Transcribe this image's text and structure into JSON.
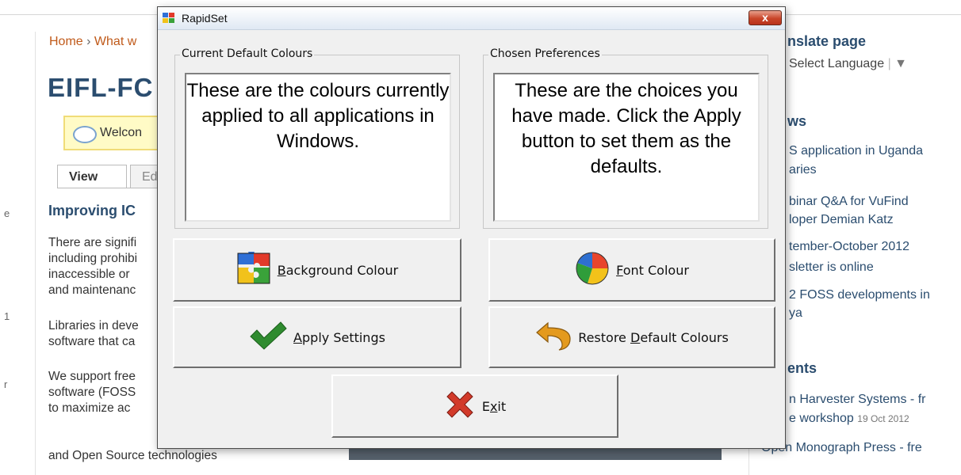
{
  "background_page": {
    "breadcrumb_home": "Home",
    "breadcrumb_sep": "›",
    "breadcrumb_next": "What w",
    "site_title": "EIFL-FC",
    "welcome_text": "Welcon",
    "tabs": [
      "View",
      "Ed"
    ],
    "section_heading": "Improving IC",
    "paragraph_lines": [
      "There are signifi",
      "including prohibi",
      "inaccessible or",
      "and maintenanc",
      "Libraries in deve",
      "software that ca",
      "We support free",
      "software (FOSS",
      "to maximize ac",
      "and Open Source technologies"
    ],
    "left_edge_glyphs": [
      "e",
      "1",
      "r"
    ],
    "right": {
      "translate_title": "nslate page",
      "language_select": "Select Language",
      "language_sep": "|",
      "language_arrow": "▼",
      "news_title": "ws",
      "news_items": [
        "S application in Uganda",
        "aries",
        "binar Q&A for VuFind",
        "loper Demian Katz",
        "tember-October 2012",
        "sletter is online",
        "2 FOSS developments in",
        "ya"
      ],
      "events_title": "ents",
      "event_items": [
        "n Harvester Systems - fr",
        "e workshop",
        "n Monograph Press - fre"
      ],
      "event_date": "19 Oct 2012",
      "event_prefix": "Ope"
    }
  },
  "dialog": {
    "title": "RapidSet",
    "close_glyph": "x",
    "current_group_label": "Current Default Colours",
    "current_text": "These are the colours currently applied to all applications in Windows.",
    "chosen_group_label": "Chosen Preferences",
    "chosen_text": "These are the choices you have made.  Click the Apply button to set them as the defaults.",
    "buttons": {
      "background": {
        "mnemonic": "B",
        "rest": "ackground Colour"
      },
      "font": {
        "mnemonic": "F",
        "rest": "ont Colour"
      },
      "apply": {
        "mnemonic": "A",
        "rest": "pply Settings"
      },
      "restore": {
        "pre": "Restore ",
        "mnemonic": "D",
        "rest": "efault Colours"
      },
      "exit": {
        "pre": "E",
        "mnemonic": "x",
        "rest": "it"
      }
    },
    "colors": {
      "puzzle": [
        "#2f6fd6",
        "#e23a2a",
        "#f1c21b",
        "#3aa23a"
      ],
      "pie": [
        "#e8452c",
        "#f3c21a",
        "#2f9d3a",
        "#2e6fd0"
      ],
      "check": "#2f8b2f",
      "restore_arrow": "#e49a1e",
      "exit_x": "#d23a2a"
    }
  }
}
